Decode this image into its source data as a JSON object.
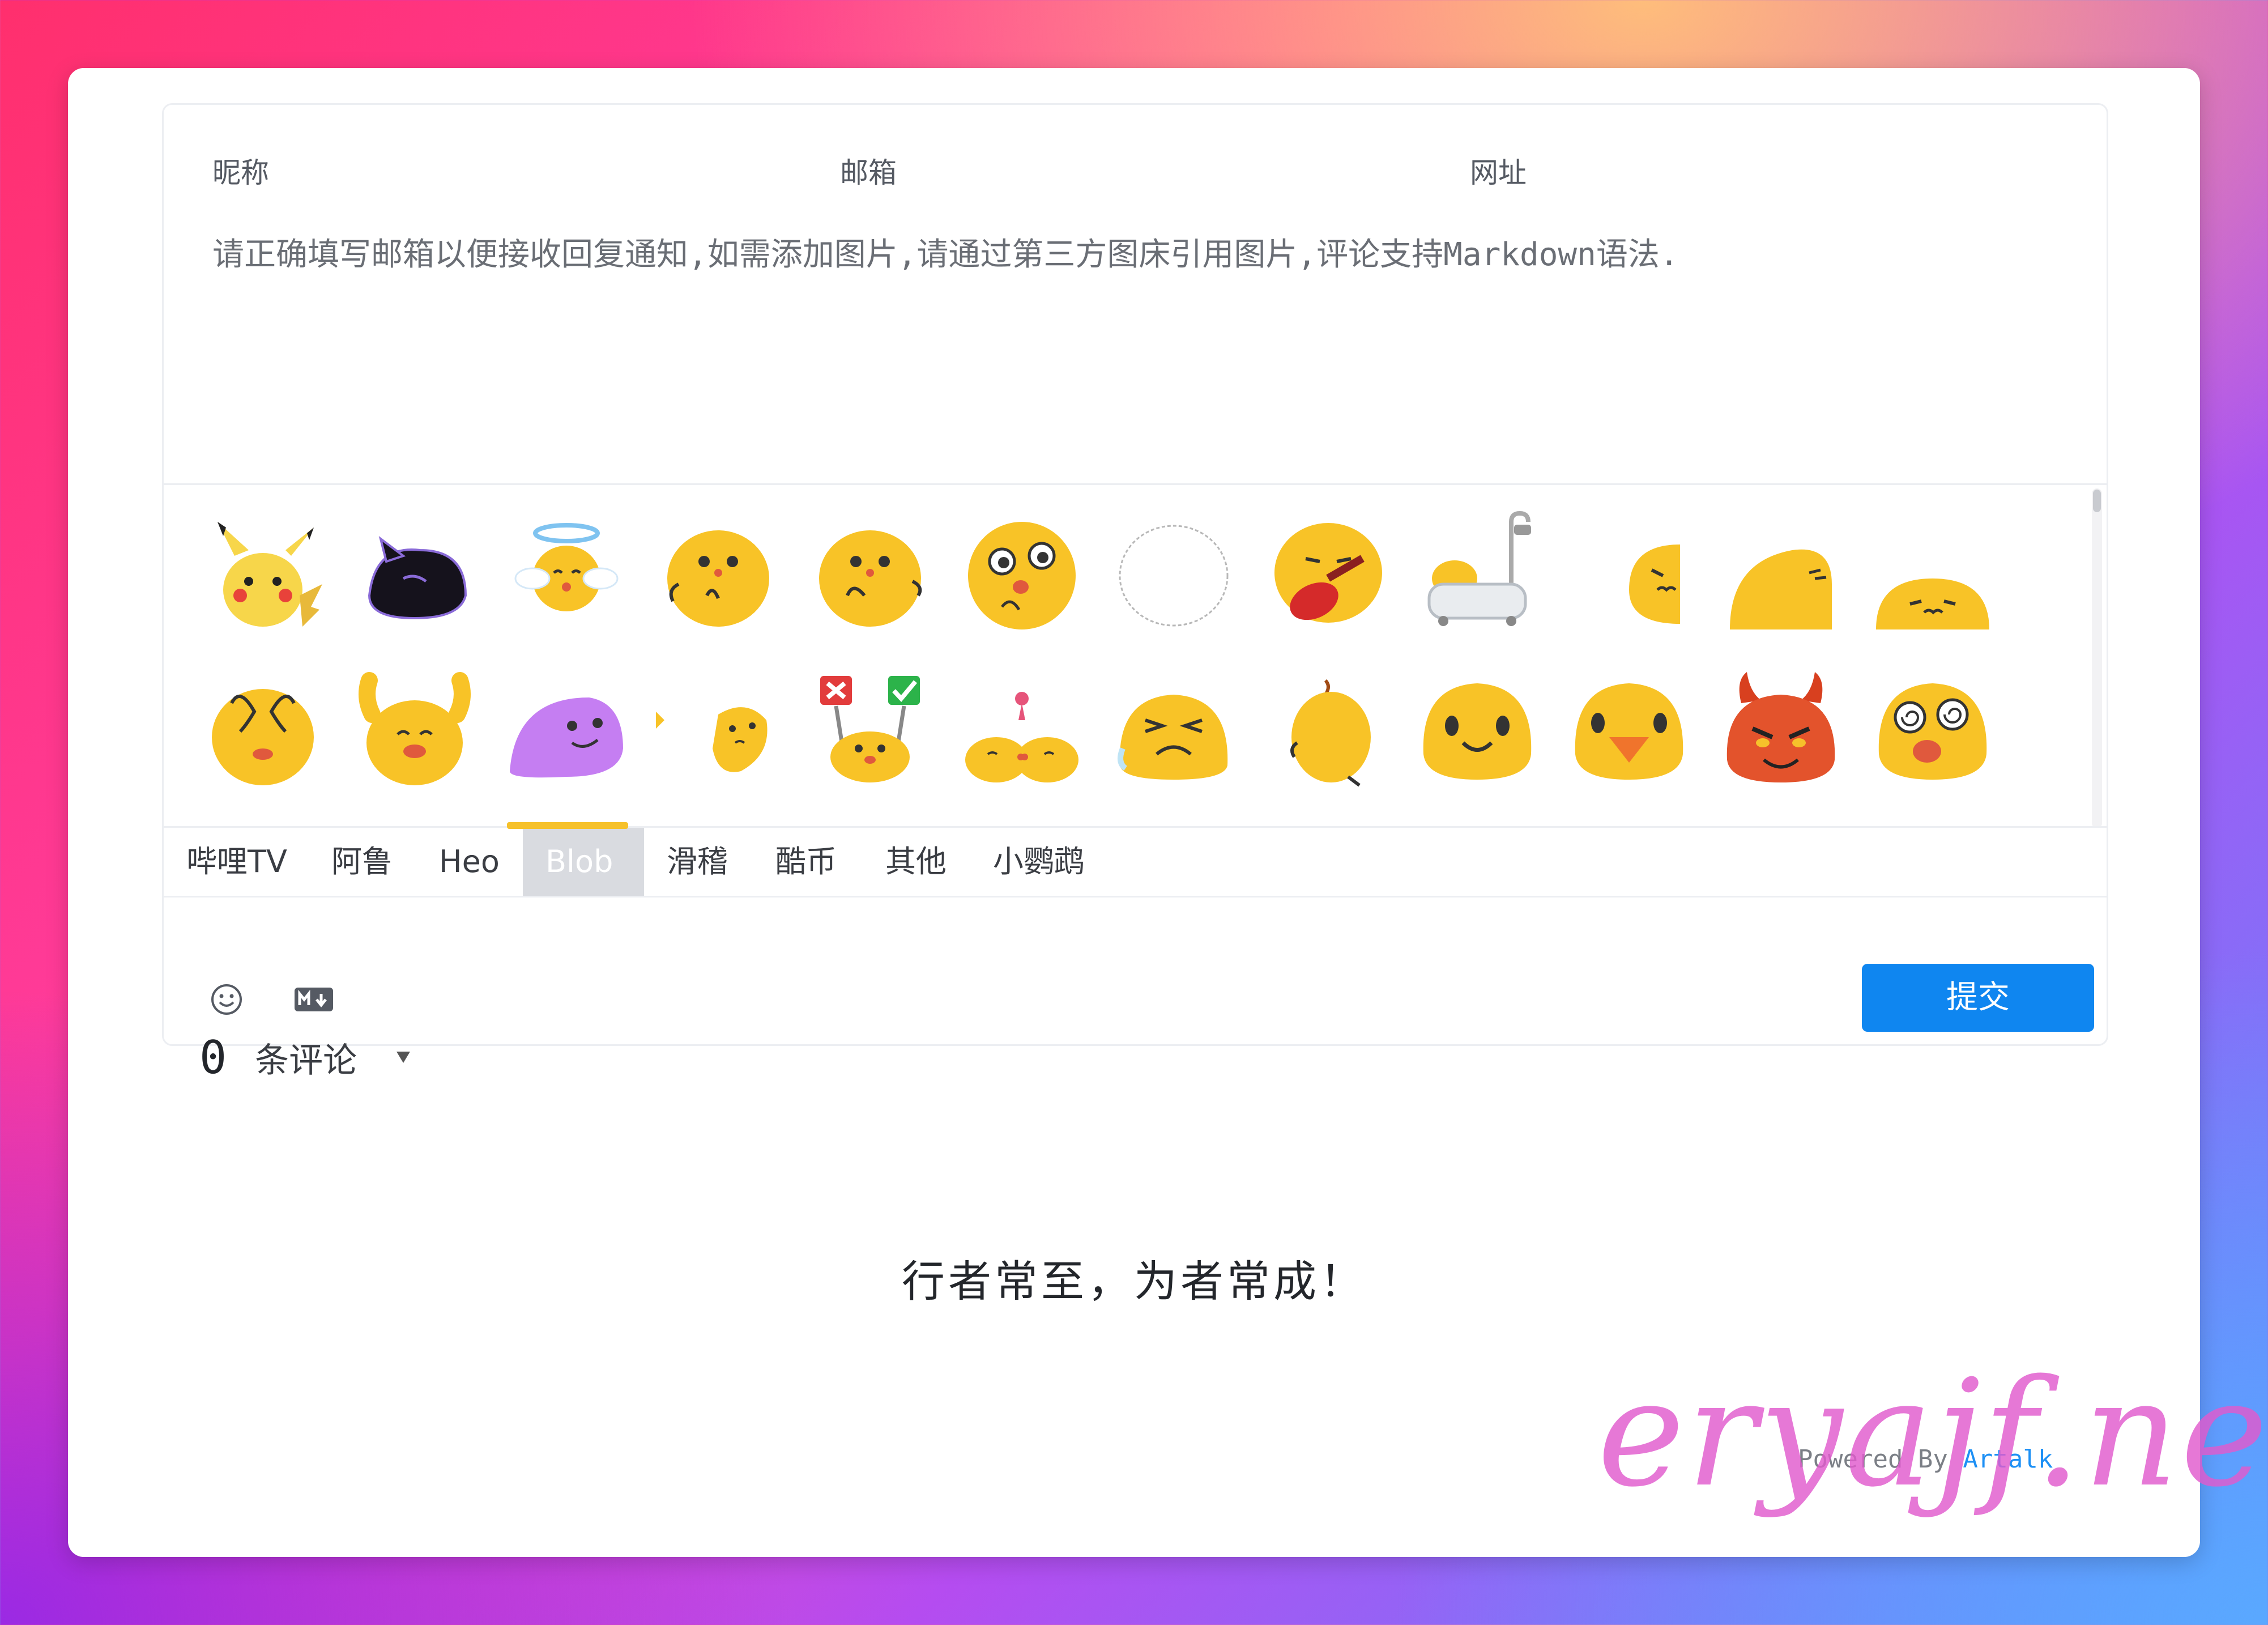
{
  "form": {
    "nick_label": "昵称",
    "email_label": "邮箱",
    "link_label": "网址",
    "textarea_placeholder": "请正确填写邮箱以便接收回复通知,如需添加图片,请通过第三方图床引用图片,评论支持Markdown语法."
  },
  "emoticons": {
    "tabs": [
      "哔哩TV",
      "阿鲁",
      "Heo",
      "Blob",
      "滑稽",
      "酷币",
      "其他",
      "小鹦鹉"
    ],
    "active_tab": "Blob",
    "rows": [
      [
        "pikachu",
        "black-cat",
        "angel-blob",
        "blob-wave",
        "blob-hug",
        "blob-surprised",
        "blob-outline",
        "blob-guitar",
        "blob-bathtub",
        "blob-peek",
        "blob-sleep",
        "blob-melt"
      ],
      [
        "blob-facepalm",
        "blob-cheer",
        "purple-blob",
        "blob-side",
        "blob-vote",
        "blob-kiss",
        "blob-sad",
        "blob-back",
        "blob-smile",
        "blob-bird",
        "blob-devil",
        "blob-dizzy"
      ]
    ]
  },
  "toolbar": {
    "emoji_icon": "smiley-icon",
    "markdown_icon": "markdown-icon",
    "submit_label": "提交"
  },
  "comments": {
    "count": "0",
    "count_label": "条评论"
  },
  "footer": {
    "slogan": "行者常至，为者常成！",
    "powered_prefix": "Powered By ",
    "powered_brand": "Artalk",
    "watermark": "eryajf.net"
  },
  "colors": {
    "accent_blue": "#0f86f0",
    "blob_yellow": "#f8c327",
    "tab_underline": "#f6c12b"
  }
}
